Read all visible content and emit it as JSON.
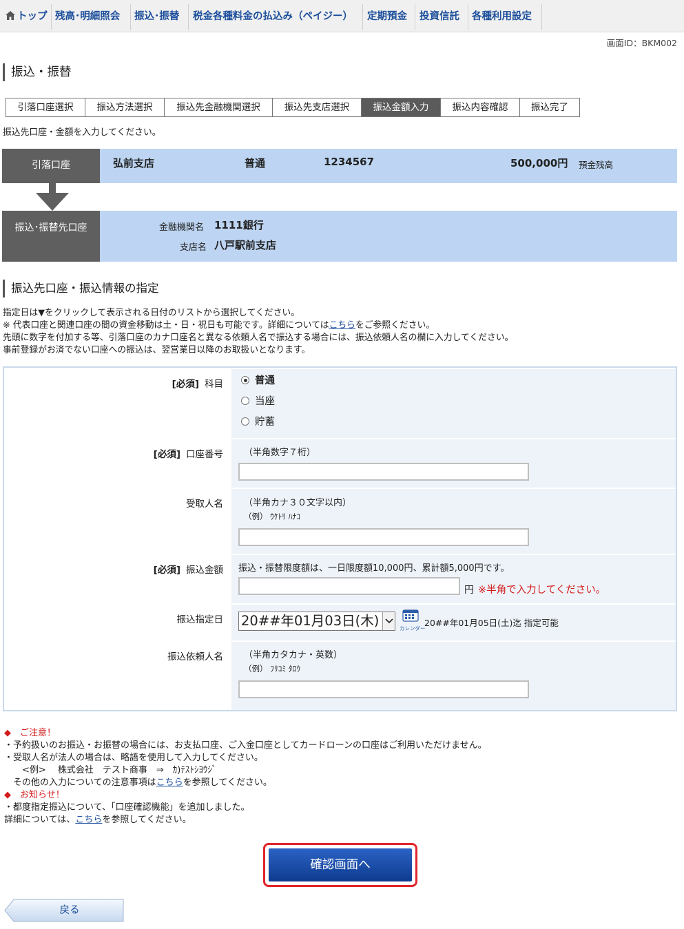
{
  "nav": {
    "items": [
      "トップ",
      "残高･明細照会",
      "振込･振替",
      "税金各種料金の払込み（ペイジー）",
      "定期預金",
      "投資信託",
      "各種利用設定"
    ]
  },
  "screen_id": "画面ID：BKM002",
  "page_title": "振込・振替",
  "steps": [
    "引落口座選択",
    "振込方法選択",
    "振込先金融機関選択",
    "振込先支店選択",
    "振込金額入力",
    "振込内容確認",
    "振込完了"
  ],
  "active_step": "振込金額入力",
  "instruction": "振込先口座・金額を入力してください。",
  "source_account": {
    "label": "引落口座",
    "branch": "弘前支店",
    "type": "普通",
    "number": "1234567",
    "balance": "500,000円",
    "balance_label": "預金残高"
  },
  "dest_account": {
    "label": "振込･振替先口座",
    "bank_label": "金融機関名",
    "bank": "1111銀行",
    "branch_label": "支店名",
    "branch": "八戸駅前支店"
  },
  "section2_title": "振込先口座・振込情報の指定",
  "notes": {
    "line1": "指定日は▼をクリックして表示される日付のリストから選択してください。",
    "line2_pre": "※ 代表口座と関連口座の間の資金移動は土・日・祝日も可能です。詳細については",
    "line2_link": "こちら",
    "line2_post": "をご参照ください。",
    "line3": "先頭に数字を付加する等、引落口座のカナ口座名と異なる依頼人名で振込する場合には、振込依頼人名の欄に入力してください。",
    "line4": "事前登録がお済でない口座への振込は、翌営業日以降のお取扱いとなります。"
  },
  "form": {
    "required_tag": "[必須]",
    "subject_label": "科目",
    "subject_options": [
      "普通",
      "当座",
      "貯蓄"
    ],
    "account_label": "口座番号",
    "account_hint": "（半角数字７桁）",
    "account_value": "",
    "payee_label": "受取人名",
    "payee_hint": "（半角カナ３０文字以内）",
    "payee_example": "（例） ｳｹﾄﾘ ﾊﾅｺ",
    "payee_value": "",
    "amount_label": "振込金額",
    "amount_hint": "振込・振替限度額は、一日限度額10,000円、累計額5,000円です。",
    "amount_value": "",
    "amount_unit": "円",
    "amount_note": "※半角で入力してください。",
    "date_label": "振込指定日",
    "date_value": "20##年01月03日(木)",
    "calendar_label": "カレンダー",
    "date_limit": "20##年01月05日(土)迄 指定可能",
    "sender_label": "振込依頼人名",
    "sender_hint": "（半角カタカナ・英数）",
    "sender_example": "（例） ﾌﾘｺﾐ ﾀﾛｳ",
    "sender_value": ""
  },
  "caution": {
    "title": "ご注意！",
    "line1": "・予約扱いのお振込・お振替の場合には、お支払口座、ご入金口座としてカードローンの口座はご利用いただけません。",
    "line2": "・受取人名が法人の場合は、略語を使用して入力してください。",
    "line3": "　　<例>　 株式会社　テスト商事　⇒　ｶ)ﾃｽﾄｼﾖｳｼﾞ",
    "line4_pre": "　その他の入力についての注意事項は",
    "line4_link": "こちら",
    "line4_post": "を参照してください。"
  },
  "notice": {
    "title": "お知らせ！",
    "line1": "・都度指定振込について、「口座確認機能」を追加しました。",
    "line2_pre": "詳細については、",
    "line2_link": "こちら",
    "line2_post": "を参照してください。"
  },
  "buttons": {
    "confirm": "確認画面へ",
    "back": "戻る"
  },
  "colors": {
    "nav_text": "#1d4f9c",
    "bar_blue": "#bdd5f2",
    "label_gray": "#5f5f5f",
    "confirm_border": "#e0262b",
    "accent_red": "#d31b1b"
  }
}
